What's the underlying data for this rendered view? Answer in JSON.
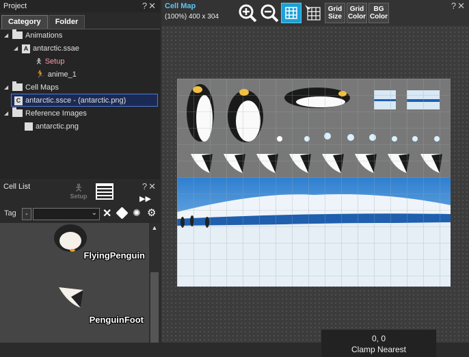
{
  "project": {
    "title": "Project",
    "controls": "?✕",
    "tabs": [
      "Category",
      "Folder"
    ],
    "tree": {
      "animations": "Animations",
      "anim_file": "antarctic.ssae",
      "setup": "Setup",
      "anime": "anime_1",
      "cellmaps": "Cell Maps",
      "cellmap_file": "antarctic.ssce - (antarctic.png)",
      "refimages": "Reference Images",
      "ref_file": "antarctic.png"
    }
  },
  "celllist": {
    "title": "Cell List",
    "setup_label": "Setup",
    "controls": "?✕",
    "tag_label": "Tag",
    "tag_value": "-",
    "cells": [
      "FlyingPenguin",
      "PenguinFoot"
    ]
  },
  "cellmap": {
    "title": "Cell Map",
    "info": "(100%) 400 x 304",
    "controls": "?✕",
    "buttons": {
      "grid_size": [
        "Grid",
        "Size"
      ],
      "grid_color": [
        "Grid",
        "Color"
      ],
      "bg_color": [
        "BG",
        "Color"
      ]
    },
    "status_coords": "0, 0",
    "status_mode": "Clamp  Nearest"
  },
  "colors": {
    "accent": "#1ea0d8",
    "setup_text": "#ff9aa6"
  }
}
